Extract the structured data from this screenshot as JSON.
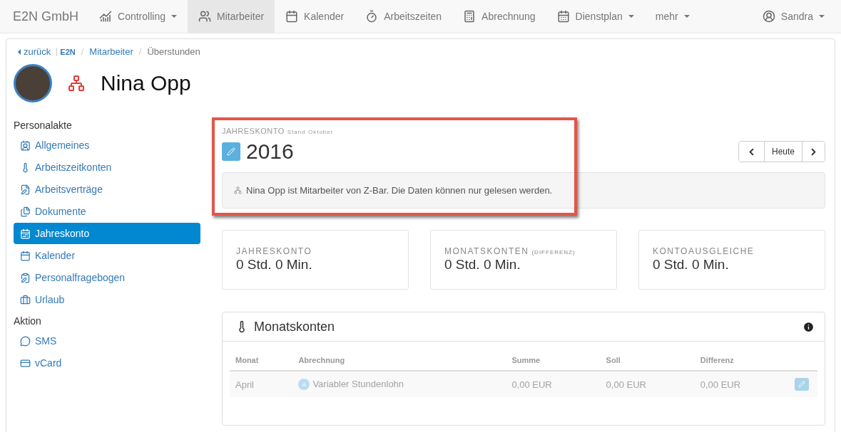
{
  "navbar": {
    "brand": "E2N GmbH",
    "items": [
      {
        "label": "Controlling",
        "dropdown": true,
        "selected": false
      },
      {
        "label": "Mitarbeiter",
        "dropdown": false,
        "selected": true
      },
      {
        "label": "Kalender",
        "dropdown": false,
        "selected": false
      },
      {
        "label": "Arbeitszeiten",
        "dropdown": false,
        "selected": false
      },
      {
        "label": "Abrechnung",
        "dropdown": false,
        "selected": false
      },
      {
        "label": "Dienstplan",
        "dropdown": true,
        "selected": false
      },
      {
        "label": "mehr",
        "dropdown": true,
        "selected": false
      }
    ],
    "user": "Sandra"
  },
  "breadcrumb": {
    "back": "zurück",
    "logo": "E2N",
    "separator": "/",
    "items": [
      "Mitarbeiter",
      "Überstunden"
    ]
  },
  "employee": {
    "name": "Nina Opp"
  },
  "sidebar": {
    "sections": [
      {
        "title": "Personalakte",
        "items": [
          {
            "label": "Allgemeines",
            "selected": false
          },
          {
            "label": "Arbeitszeitkonten",
            "selected": false
          },
          {
            "label": "Arbeitsverträge",
            "selected": false
          },
          {
            "label": "Dokumente",
            "selected": false
          },
          {
            "label": "Jahreskonto",
            "selected": true
          },
          {
            "label": "Kalender",
            "selected": false
          },
          {
            "label": "Personalfragebogen",
            "selected": false
          },
          {
            "label": "Urlaub",
            "selected": false
          }
        ]
      },
      {
        "title": "Aktion",
        "items": [
          {
            "label": "SMS",
            "selected": false
          },
          {
            "label": "vCard",
            "selected": false
          }
        ]
      }
    ]
  },
  "header": {
    "label": "JAHRESKONTO",
    "sublabel": "Stand Oktober",
    "year": "2016",
    "today": "Heute",
    "notice": "Nina Opp ist Mitarbeiter von Z-Bar. Die Daten können nur gelesen werden.",
    "highlighted": true
  },
  "cards": [
    {
      "label": "JAHRESKONTO",
      "value": "0 Std. 0 Min."
    },
    {
      "label": "MONATSKONTEN",
      "note": "(DIFFERENZ)",
      "value": "0 Std. 0 Min."
    },
    {
      "label": "KONTOAUSGLEICHE",
      "value": "0 Std. 0 Min."
    }
  ],
  "monatskonten": {
    "title": "Monatskonten",
    "columns": [
      "Monat",
      "Abrechnung",
      "Summe",
      "Soll",
      "Differenz"
    ],
    "rows": [
      {
        "disabled": true,
        "badge": "A",
        "cells": [
          "April",
          "Variabler Stundenlohn",
          "0,00 EUR",
          "0,00 EUR",
          "0,00 EUR"
        ]
      }
    ]
  }
}
